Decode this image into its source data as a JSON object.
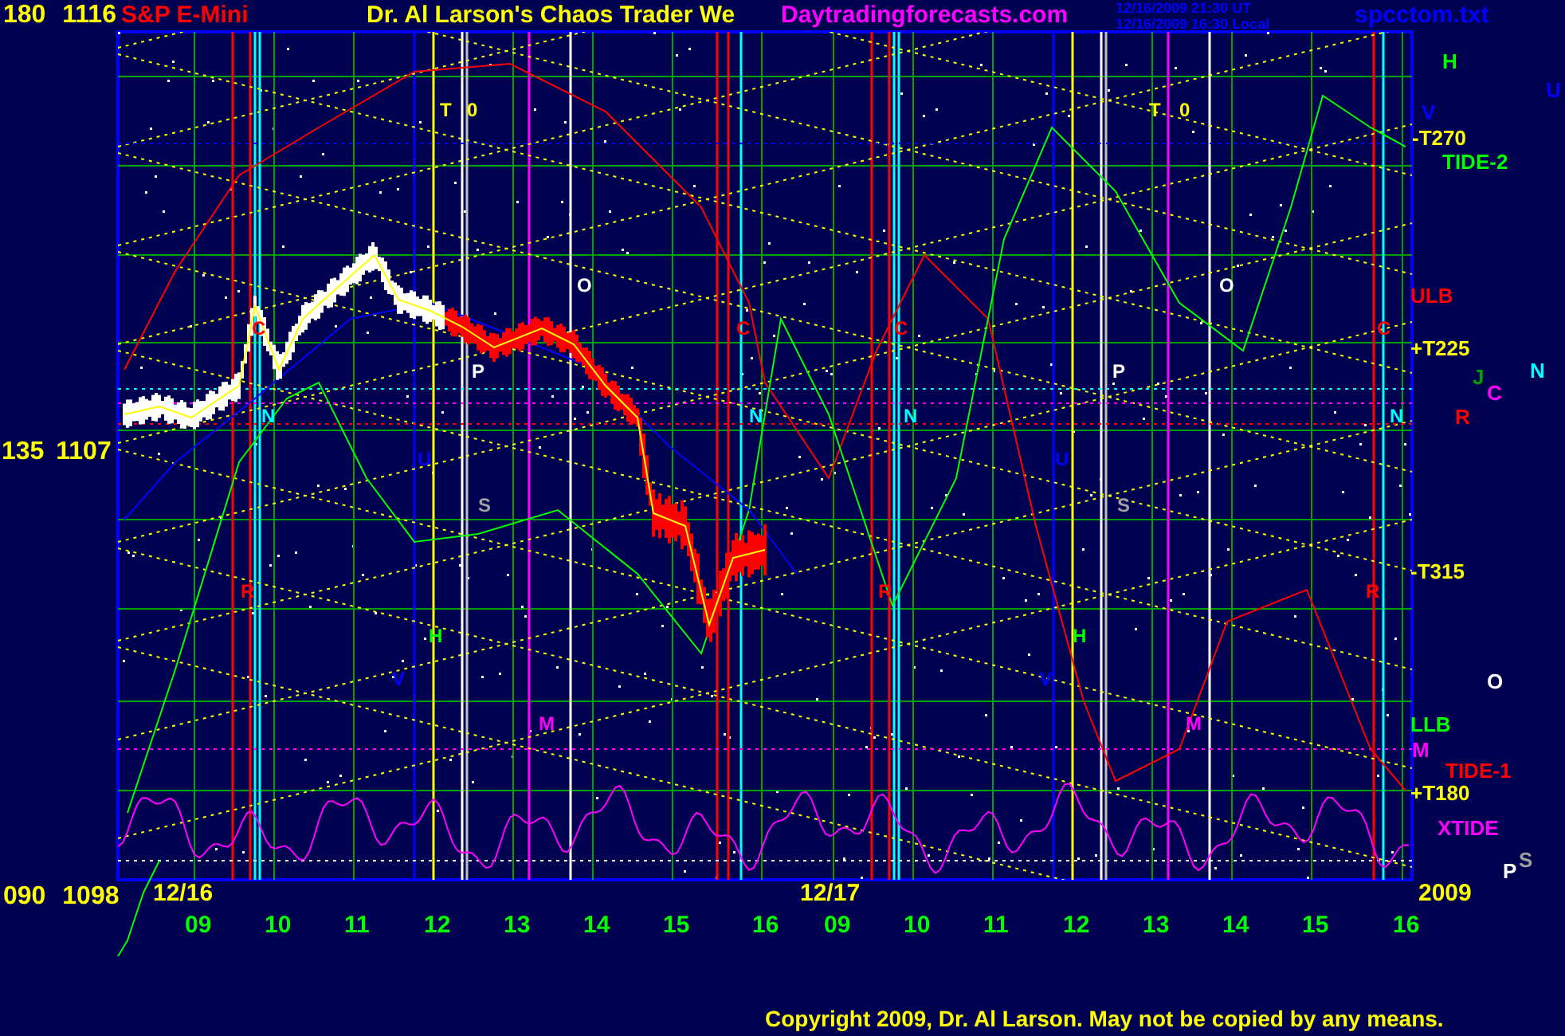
{
  "header": {
    "symbol": "S&P E-Mini",
    "title": "Dr. Al Larson's Chaos Trader We",
    "site": "Daytradingforecasts.com",
    "timestamps": [
      "12/16/2009 21:30 UT",
      "12/16/2009 16:30 Local"
    ],
    "file": "spcctom.txt"
  },
  "y_axis_labels": [
    "180 1116",
    "135 1107",
    "090 1098"
  ],
  "date_labels": [
    "12/16",
    "12/17",
    "2009"
  ],
  "x_axis_labels": [
    "09",
    "10",
    "11",
    "12",
    "13",
    "14",
    "15",
    "16",
    "09",
    "10",
    "11",
    "12",
    "13",
    "14",
    "15",
    "16"
  ],
  "plot_markers": [
    {
      "text": "T",
      "color": "#ffff00"
    },
    {
      "text": "0",
      "color": "#ffff00"
    },
    {
      "text": "T",
      "color": "#ffff00"
    },
    {
      "text": "0",
      "color": "#ffff00"
    },
    {
      "text": "O",
      "color": "#ffffff"
    },
    {
      "text": "O",
      "color": "#ffffff"
    },
    {
      "text": "C",
      "color": "#ff0000"
    },
    {
      "text": "C",
      "color": "#ff0000"
    },
    {
      "text": "C",
      "color": "#ff0000"
    },
    {
      "text": "C",
      "color": "#ff0000"
    },
    {
      "text": "P",
      "color": "#ffffff"
    },
    {
      "text": "P",
      "color": "#ffffff"
    },
    {
      "text": "N",
      "color": "#00ffff"
    },
    {
      "text": "N",
      "color": "#00ffff"
    },
    {
      "text": "N",
      "color": "#00ffff"
    },
    {
      "text": "N",
      "color": "#00ffff"
    },
    {
      "text": "U",
      "color": "#0000ff"
    },
    {
      "text": "U",
      "color": "#0000ff"
    },
    {
      "text": "S",
      "color": "#a0a0a0"
    },
    {
      "text": "S",
      "color": "#a0a0a0"
    },
    {
      "text": "R",
      "color": "#ff0000"
    },
    {
      "text": "R",
      "color": "#ff0000"
    },
    {
      "text": "R",
      "color": "#ff0000"
    },
    {
      "text": "H",
      "color": "#00ff00"
    },
    {
      "text": "H",
      "color": "#00ff00"
    },
    {
      "text": "V",
      "color": "#0000ff"
    },
    {
      "text": "V",
      "color": "#0000ff"
    },
    {
      "text": "M",
      "color": "#ff00ff"
    },
    {
      "text": "M",
      "color": "#ff00ff"
    }
  ],
  "right_labels": [
    {
      "text": "H",
      "color": "#00ff00"
    },
    {
      "text": "U",
      "color": "#0000ff"
    },
    {
      "text": "V",
      "color": "#0000ff"
    },
    {
      "text": "-T270",
      "color": "#ffff00"
    },
    {
      "text": "TIDE-2",
      "color": "#00ff00"
    },
    {
      "text": "ULB",
      "color": "#ff0000"
    },
    {
      "text": "+T225",
      "color": "#ffff00"
    },
    {
      "text": "J",
      "color": "#00a000"
    },
    {
      "text": "C",
      "color": "#ff00ff"
    },
    {
      "text": "N",
      "color": "#00ffff"
    },
    {
      "text": "R",
      "color": "#ff0000"
    },
    {
      "text": "-T315",
      "color": "#ffff00"
    },
    {
      "text": "O",
      "color": "#ffffff"
    },
    {
      "text": "LLB",
      "color": "#00ff00"
    },
    {
      "text": "M",
      "color": "#ff00ff"
    },
    {
      "text": "TIDE-1",
      "color": "#ff0000"
    },
    {
      "text": "+T180",
      "color": "#ffff00"
    },
    {
      "text": "XTIDE",
      "color": "#ff00ff"
    },
    {
      "text": "P",
      "color": "#ffffff"
    },
    {
      "text": "S",
      "color": "#a0a0a0"
    }
  ],
  "copyright": "Copyright 2009, Dr. Al Larson. May not be copied by any means."
}
